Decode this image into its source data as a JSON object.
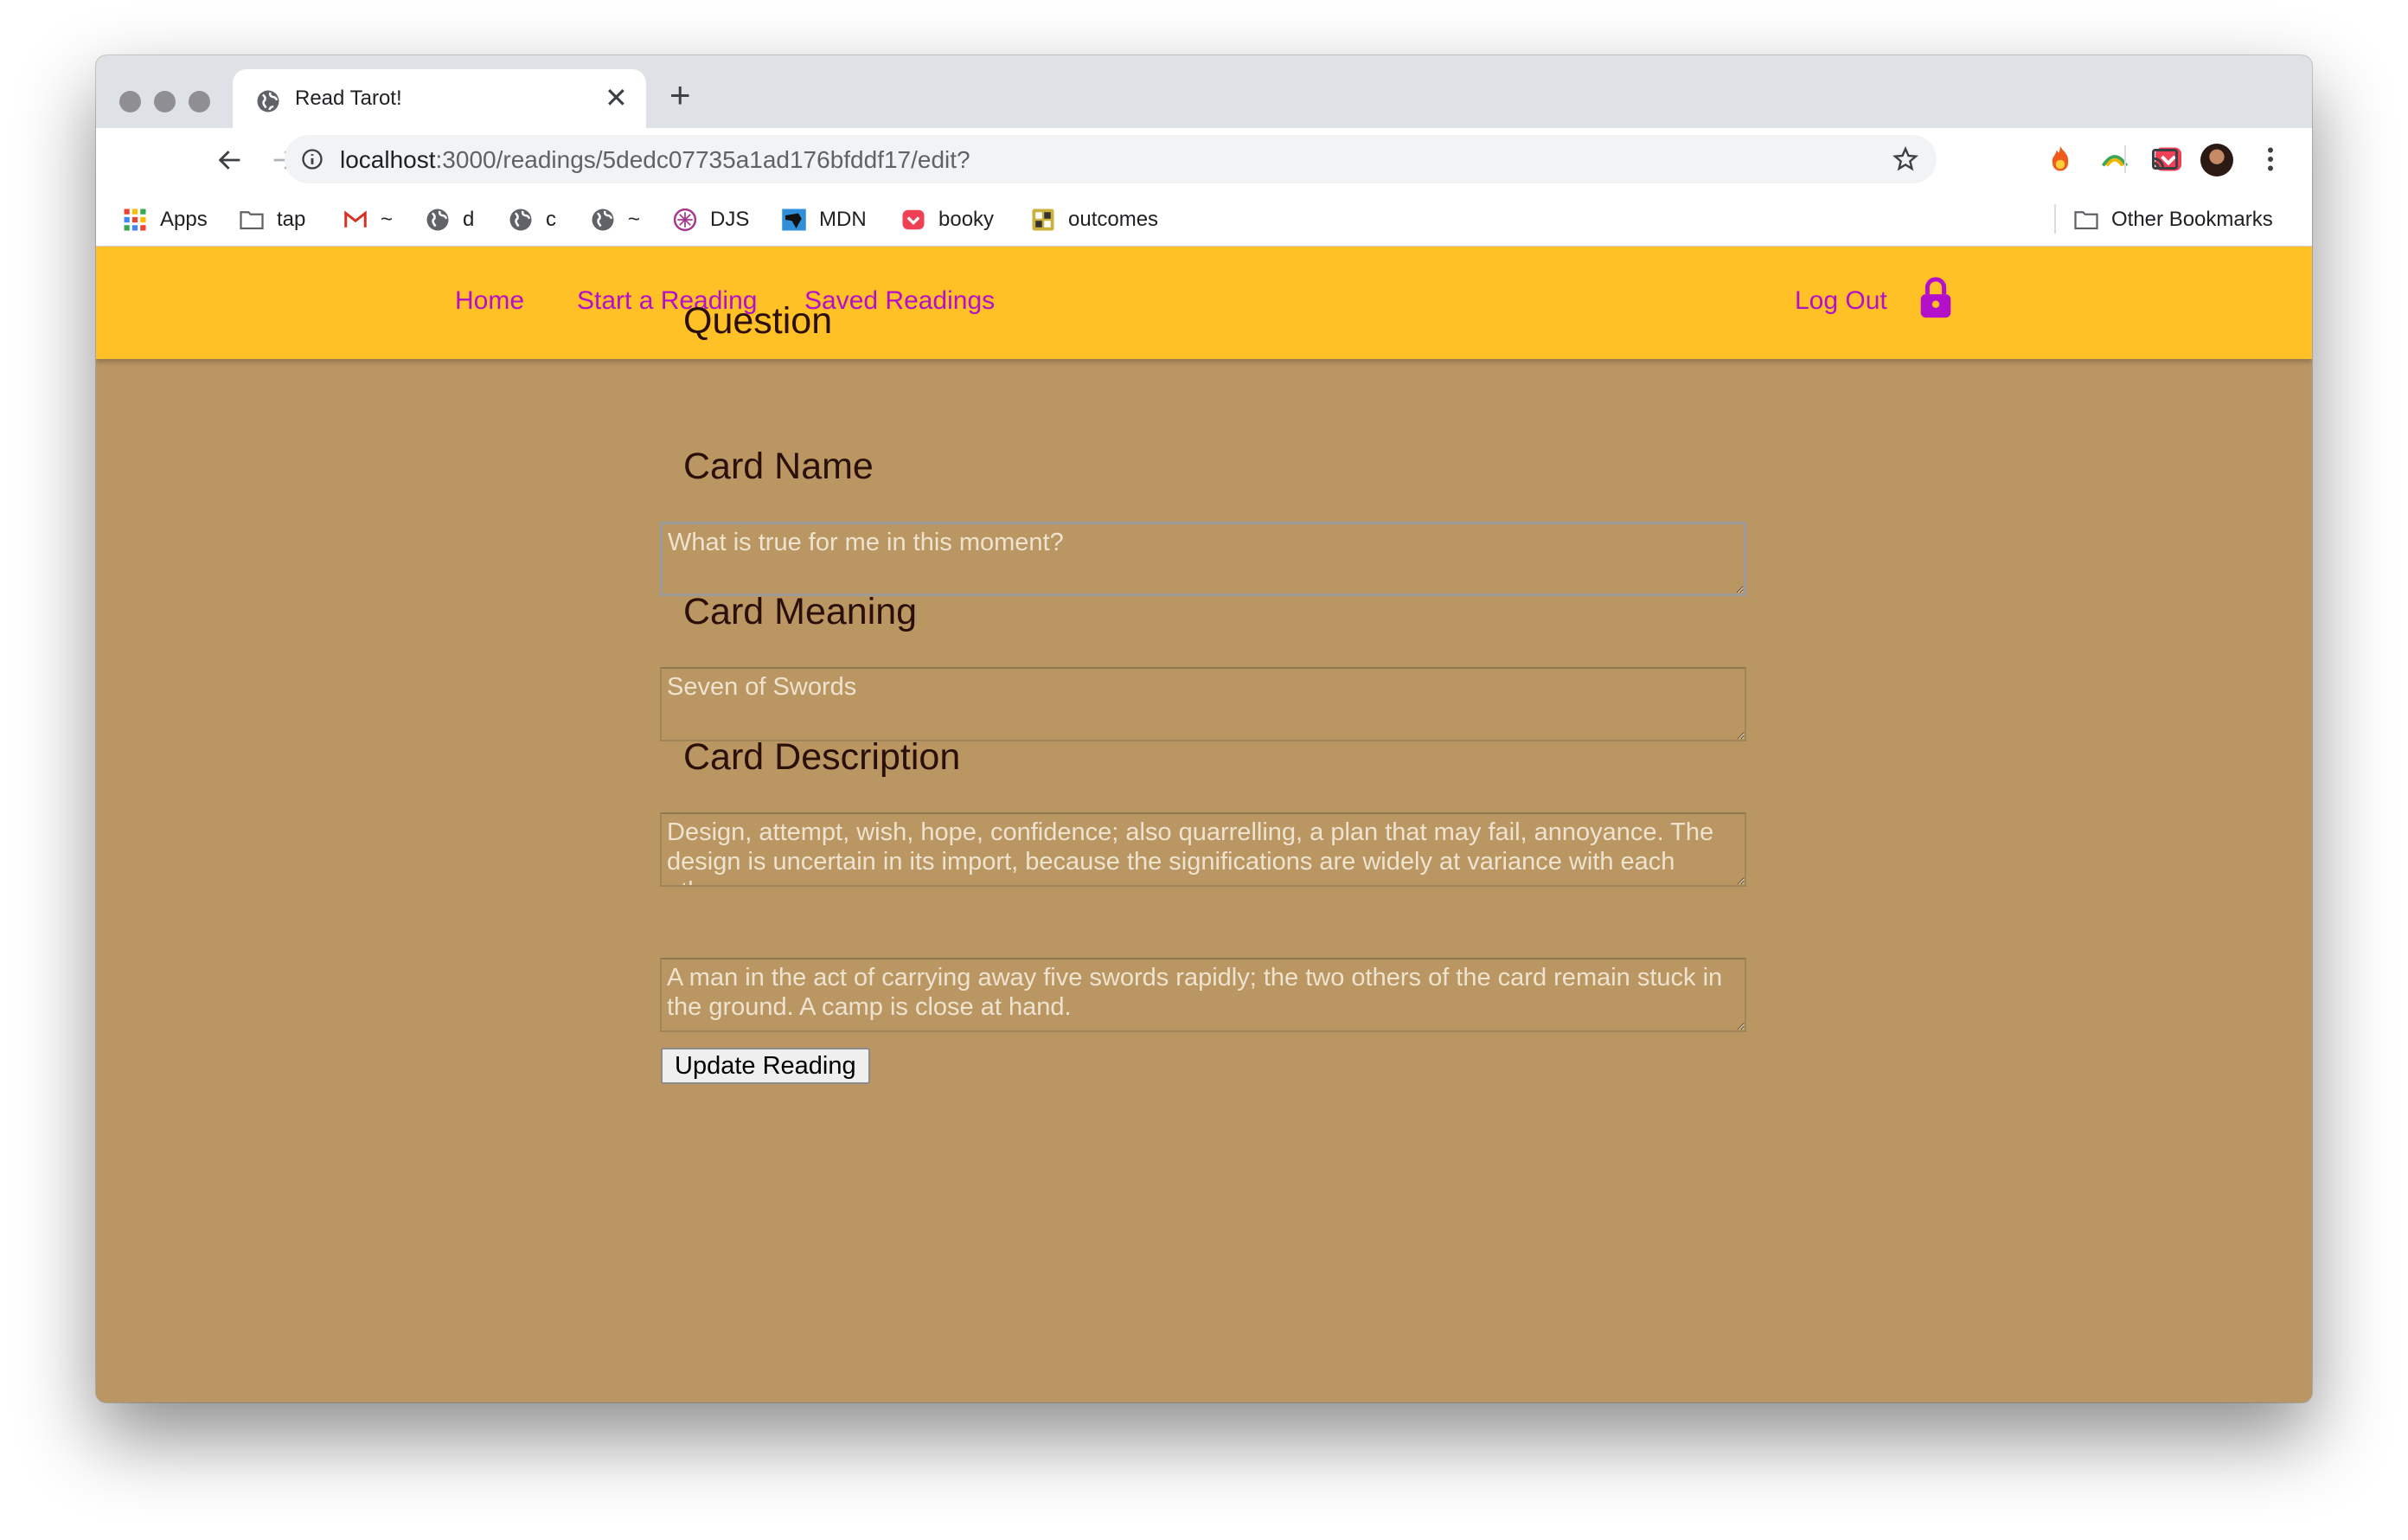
{
  "browser": {
    "tab": {
      "title": "Read Tarot!"
    },
    "url": {
      "host": "localhost",
      "rest": ":3000/readings/5dedc07735a1ad176bfddf17/edit?"
    },
    "bookmarks": [
      {
        "label": "Apps",
        "icon": "apps-grid-icon"
      },
      {
        "label": "tap",
        "icon": "folder-icon"
      },
      {
        "label": "~",
        "icon": "gmail-icon"
      },
      {
        "label": "d",
        "icon": "globe-icon"
      },
      {
        "label": "c",
        "icon": "globe-icon"
      },
      {
        "label": "~",
        "icon": "globe-icon"
      },
      {
        "label": "DJS",
        "icon": "djs-icon"
      },
      {
        "label": "MDN",
        "icon": "mdn-icon"
      },
      {
        "label": "booky",
        "icon": "pocket-icon"
      },
      {
        "label": "outcomes",
        "icon": "outcomes-icon"
      }
    ],
    "other_bookmarks": "Other Bookmarks"
  },
  "nav": {
    "home": "Home",
    "start": "Start a Reading",
    "saved": "Saved Readings",
    "logout": "Log Out",
    "accent": "#b40fc9",
    "bar_color": "#ffc125"
  },
  "form": {
    "question": {
      "label": "Question",
      "placeholder": "What is true for me in this moment?"
    },
    "card_name": {
      "label": "Card Name",
      "placeholder": "Seven of Swords"
    },
    "card_meaning": {
      "label": "Card Meaning",
      "placeholder": "Design, attempt, wish, hope, confidence; also quarrelling, a plan that may fail, annoyance. The design is uncertain in its import, because the significations are widely at variance with each other."
    },
    "card_description": {
      "label": "Card Description",
      "placeholder": "A man in the act of carrying away five swords rapidly; the two others of the card remain stuck in the ground. A camp is close at hand."
    },
    "submit": "Update Reading"
  }
}
